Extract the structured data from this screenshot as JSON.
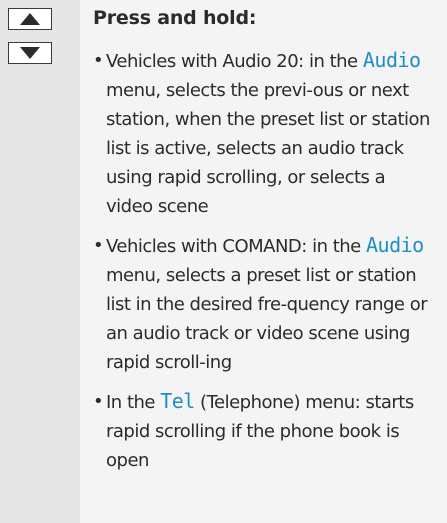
{
  "keys": {
    "up_icon": "triangle-up-icon",
    "down_icon": "triangle-down-icon"
  },
  "heading": "Press and hold:",
  "items": [
    {
      "pre": "Vehicles with Audio 20: in the",
      "menu": "Audio",
      "post": " menu, selects the previ-ous or next station, when the preset list or station list is active, selects an audio track using rapid scrolling, or selects a video scene"
    },
    {
      "pre": "Vehicles with COMAND: in the",
      "menu": "Audio",
      "post": " menu, selects a preset list or station list in the desired fre-quency range or an audio track or video scene using rapid scroll-ing"
    },
    {
      "pre": "In the ",
      "menu": "Tel",
      "post": " (Telephone) menu: starts rapid scrolling if the phone book is open"
    }
  ],
  "colors": {
    "menu_text": "#1e8fc3",
    "left_column": "#e6e6e6",
    "right_column": "#f4f4f4"
  }
}
